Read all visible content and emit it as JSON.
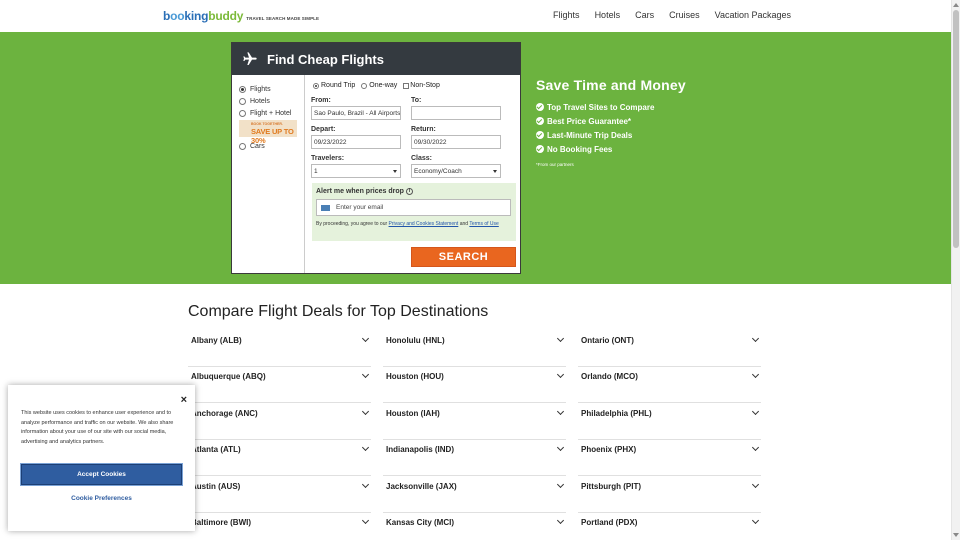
{
  "header": {
    "logo_text_1": "b",
    "logo_text_oo": "oo",
    "logo_text_2": "king",
    "logo_text_buddy": "buddy",
    "tagline": "TRAVEL SEARCH MADE SIMPLE",
    "nav": [
      "Flights",
      "Hotels",
      "Cars",
      "Cruises",
      "Vacation Packages"
    ]
  },
  "search": {
    "title": "Find Cheap Flights",
    "types": [
      {
        "label": "Flights",
        "selected": true
      },
      {
        "label": "Hotels",
        "selected": false
      },
      {
        "label": "Flight + Hotel",
        "selected": false
      },
      {
        "label": "Cars",
        "selected": false
      }
    ],
    "promo_small": "BOOK TOGETHER.",
    "promo_big": "SAVE UP TO 30%",
    "trip": {
      "round_trip": "Round Trip",
      "one_way": "One-way",
      "non_stop": "Non-Stop"
    },
    "from_label": "From:",
    "from_value": "Sao Paulo, Brazil - All Airports",
    "to_label": "To:",
    "to_value": "",
    "depart_label": "Depart:",
    "depart_value": "09/23/2022",
    "return_label": "Return:",
    "return_value": "09/30/2022",
    "travelers_label": "Travelers:",
    "travelers_value": "1",
    "class_label": "Class:",
    "class_value": "Economy/Coach",
    "alert_title": "Alert me when prices drop",
    "email_placeholder": "Enter your email",
    "legal_pre": "By proceeding, you agree to our ",
    "legal_link1": "Privacy and Cookies Statement",
    "legal_mid": " and ",
    "legal_link2": "Terms of Use",
    "button": "SEARCH"
  },
  "benefits": {
    "heading": "Save Time and Money",
    "items": [
      "Top Travel Sites to Compare",
      "Best Price Guarantee*",
      "Last-Minute Trip Deals",
      "No Booking Fees"
    ],
    "footnote": "*From our partners"
  },
  "compare": {
    "title": "Compare Flight Deals for Top Destinations",
    "col1": [
      "Albany (ALB)",
      "Albuquerque (ABQ)",
      "Anchorage (ANC)",
      "Atlanta (ATL)",
      "Austin (AUS)",
      "Baltimore (BWI)"
    ],
    "col2": [
      "Honolulu (HNL)",
      "Houston (HOU)",
      "Houston (IAH)",
      "Indianapolis (IND)",
      "Jacksonville (JAX)",
      "Kansas City (MCI)"
    ],
    "col3": [
      "Ontario (ONT)",
      "Orlando (MCO)",
      "Philadelphia (PHL)",
      "Phoenix (PHX)",
      "Pittsburgh (PIT)",
      "Portland (PDX)"
    ]
  },
  "cookie": {
    "close": "×",
    "text": "This website uses cookies to enhance user experience and to analyze performance and traffic on our website. We also share information about your use of our site with our social media, advertising and analytics partners.",
    "accept": "Accept Cookies",
    "prefs": "Cookie Preferences"
  },
  "colors": {
    "green": "#6cb33f",
    "dark_header": "#343a40",
    "orange": "#e9661f",
    "cookie_blue": "#2f5da0"
  }
}
